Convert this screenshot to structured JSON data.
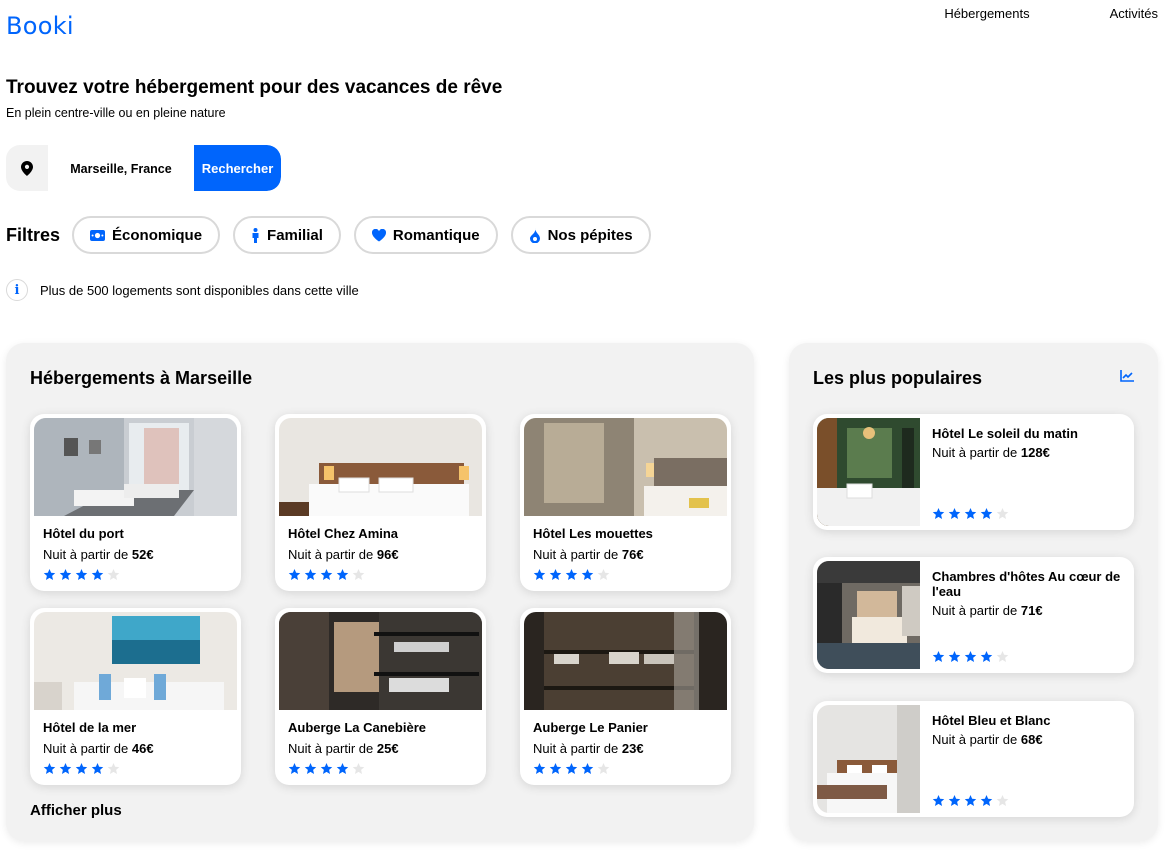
{
  "brand": {
    "logo": "Booki",
    "color": "#0065FC"
  },
  "nav": {
    "items": [
      "Hébergements",
      "Activités"
    ]
  },
  "hero": {
    "title": "Trouvez votre hébergement pour des vacances de rêve",
    "subtitle": "En plein centre-ville ou en pleine nature"
  },
  "search": {
    "location": "Marseille, France",
    "button": "Rechercher",
    "icon": "location-pin-icon"
  },
  "filters": {
    "label": "Filtres",
    "items": [
      {
        "label": "Économique",
        "icon": "money-icon"
      },
      {
        "label": "Familial",
        "icon": "person-icon"
      },
      {
        "label": "Romantique",
        "icon": "heart-icon"
      },
      {
        "label": "Nos pépites",
        "icon": "flame-icon"
      }
    ]
  },
  "info": {
    "text": "Plus de 500 logements sont disponibles dans cette ville"
  },
  "listings": {
    "title": "Hébergements à Marseille",
    "price_prefix": "Nuit à partir de ",
    "items": [
      {
        "name": "Hôtel du port",
        "price": "52€",
        "rating": 4
      },
      {
        "name": "Hôtel Chez Amina",
        "price": "96€",
        "rating": 4
      },
      {
        "name": "Hôtel Les mouettes",
        "price": "76€",
        "rating": 4
      },
      {
        "name": "Hôtel de la mer",
        "price": "46€",
        "rating": 4
      },
      {
        "name": "Auberge La Canebière",
        "price": "25€",
        "rating": 4
      },
      {
        "name": "Auberge Le Panier",
        "price": "23€",
        "rating": 4
      }
    ],
    "more": "Afficher plus"
  },
  "popular": {
    "title": "Les plus populaires",
    "icon": "trend-chart-icon",
    "items": [
      {
        "name": "Hôtel Le soleil du matin",
        "price": "128€",
        "rating": 4
      },
      {
        "name": "Chambres d'hôtes Au cœur de l'eau",
        "price": "71€",
        "rating": 4
      },
      {
        "name": "Hôtel Bleu et Blanc",
        "price": "68€",
        "rating": 4
      }
    ]
  },
  "colors": {
    "accent": "#0065FC",
    "panel": "#F2F2F2",
    "star_off": "#E6E6E6"
  }
}
